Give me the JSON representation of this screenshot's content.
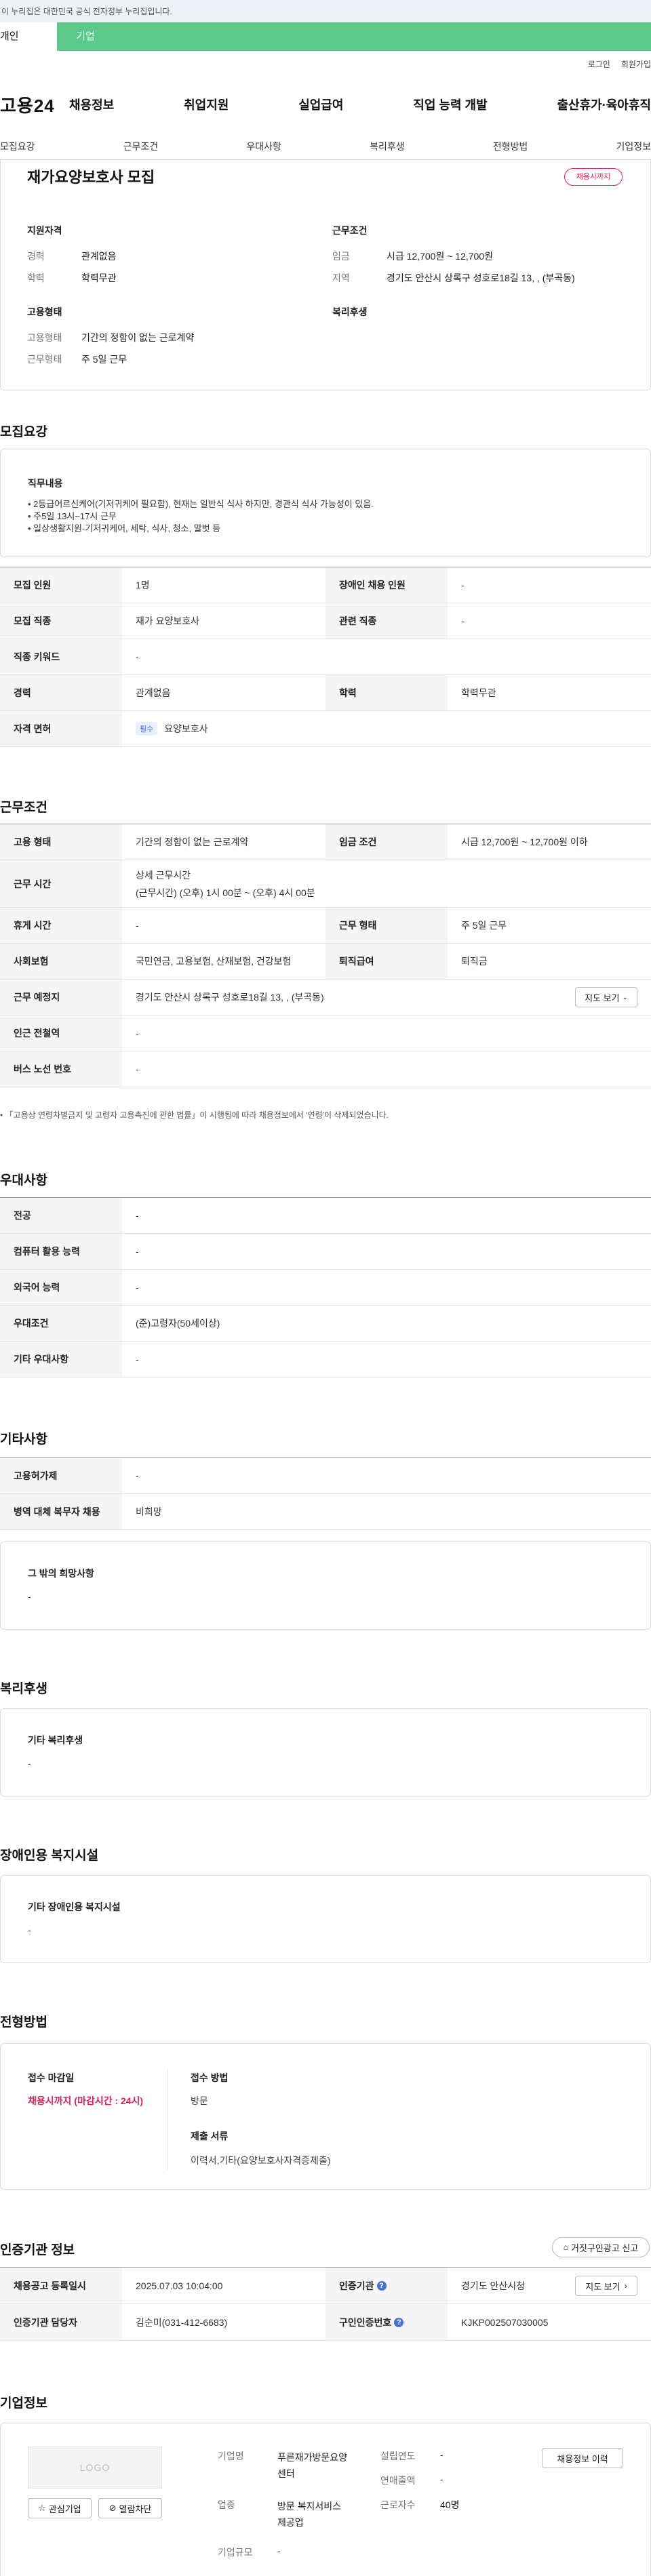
{
  "gov_banner": "이 누리집은 대한민국 공식 전자정부 누리집입니다.",
  "top_tabs": {
    "personal": "개인",
    "company": "기업"
  },
  "util": {
    "login": "로그인",
    "join": "회원가입"
  },
  "logo": "고용24",
  "menu": [
    "채용정보",
    "취업지원",
    "실업급여",
    "직업 능력 개발",
    "출산휴가·육아휴직"
  ],
  "subnav": [
    "모집요강",
    "근무조건",
    "우대사항",
    "복리후생",
    "전형방법",
    "기업정보"
  ],
  "job": {
    "title": "재가요양보호사 모집",
    "status_badge": "채용시까지",
    "qual_heading": "지원자격",
    "career_label": "경력",
    "career_value": "관계없음",
    "edu_label": "학력",
    "edu_value": "학력무관",
    "cond_heading": "근무조건",
    "wage_label": "임금",
    "wage_value": "시급 12,700원 ~ 12,700원",
    "area_label": "지역",
    "area_value": "경기도 안산시 상록구 성호로18길 13, , (부곡동)",
    "emptype_heading": "고용형태",
    "emptype_label": "고용형태",
    "emptype_value": "기간의 정함이 없는 근로계약",
    "workform_label": "근무형태",
    "workform_value": "주 5일 근무",
    "welfare_heading": "복리후생"
  },
  "recruit": {
    "heading": "모집요강",
    "duty_heading": "직무내용",
    "duties": [
      "• 2등급어르신케어(기저귀케어 필요함), 현재는 일반식 식사 하지만, 경관식 식사 가능성이 있음.",
      "• 주5일 13시~17시 근무",
      "• 일상생활지원-기저귀케어, 세탁, 식사, 청소, 말벗 등"
    ],
    "rows": {
      "count_label": "모집 인원",
      "count_value": "1명",
      "disabled_label": "장애인 채용 인원",
      "disabled_value": "-",
      "job_label": "모집 직종",
      "job_value": "재가 요양보호사",
      "related_label": "관련 직종",
      "related_value": "-",
      "keyword_label": "직종 키워드",
      "keyword_value": "-",
      "career_label": "경력",
      "career_value": "관계없음",
      "edu_label": "학력",
      "edu_value": "학력무관",
      "license_label": "자격 면허",
      "license_tag": "필수",
      "license_value": "요양보호사"
    }
  },
  "cond": {
    "heading": "근무조건",
    "emp_label": "고용 형태",
    "emp_value": "기간의 정함이 없는 근로계약",
    "wage_label": "임금 조건",
    "wage_value": "시급 12,700원 ~ 12,700원 이하",
    "time_label": "근무 시간",
    "time_value1": "상세 근무시간",
    "time_value2": "(근무시간) (오후) 1시 00분 ~ (오후) 4시 00분",
    "rest_label": "휴게 시간",
    "rest_value": "-",
    "form_label": "근무 형태",
    "form_value": "주 5일 근무",
    "ins_label": "사회보험",
    "ins_value": "국민연금, 고용보험, 산재보험, 건강보험",
    "sev_label": "퇴직급여",
    "sev_value": "퇴직금",
    "place_label": "근무 예정지",
    "place_value": "경기도 안산시 상록구 성호로18길 13, , (부곡동)",
    "map_btn": "지도 보기",
    "subway_label": "인근 전철역",
    "subway_value": "-",
    "bus_label": "버스 노선 번호",
    "bus_value": "-",
    "note": "「고용상 연령차별금지 및 고령자 고용촉진에 관한 법률」이 시행됨에 따라 채용정보에서 '연령'이 삭제되었습니다."
  },
  "pref": {
    "heading": "우대사항",
    "major_label": "전공",
    "major_value": "-",
    "pc_label": "컴퓨터 활용 능력",
    "pc_value": "-",
    "lang_label": "외국어 능력",
    "lang_value": "-",
    "cond_label": "우대조건",
    "cond_value": "(준)고령자(50세이상)",
    "etc_label": "기타 우대사항",
    "etc_value": "-"
  },
  "etc": {
    "heading": "기타사항",
    "permit_label": "고용허가제",
    "permit_value": "-",
    "army_label": "병역 대체 복무자 채용",
    "army_value": "비희망",
    "other_heading": "그 밖의 희망사항",
    "other_value": "-"
  },
  "welfare": {
    "heading": "복리후생",
    "box_heading": "기타 복리후생",
    "box_value": "-"
  },
  "facility": {
    "heading": "장애인용 복지시설",
    "box_heading": "기타 장애인용 복지시설",
    "box_value": "-"
  },
  "selection": {
    "heading": "전형방법",
    "deadline_label": "접수 마감일",
    "deadline_value": "채용시까지 (마감시간 : 24시)",
    "method_label": "접수 방법",
    "method_value": "방문",
    "docs_label": "제출 서류",
    "docs_value": "이력서,기타(요양보호사자격증제출)"
  },
  "cert": {
    "heading": "인증기관 정보",
    "report_btn": "거짓구인광고 신고",
    "date_label": "채용공고 등록일시",
    "date_value": "2025.07.03 10:04:00",
    "org_label": "인증기관",
    "org_value": "경기도 안산시청",
    "map_btn": "지도 보기",
    "manager_label": "인증기관 담당자",
    "manager_value": "김순미(031-412-6683)",
    "id_label": "구인인증번호",
    "id_value": "KJKP002507030005"
  },
  "company": {
    "heading": "기업정보",
    "logo_text": "LOGO",
    "fav_btn": "관심기업",
    "block_btn": "열람차단",
    "name_label": "기업명",
    "name_value": "푸른재가방문요양센터",
    "biz_label": "업종",
    "biz_value": "방문 복지서비스 제공업",
    "size_label": "기업규모",
    "size_value": "-",
    "year_label": "설립연도",
    "year_value": "-",
    "sales_label": "연매출액",
    "sales_value": "-",
    "emp_label": "근로자수",
    "emp_value": "40명",
    "history_btn": "채용정보 이력"
  }
}
